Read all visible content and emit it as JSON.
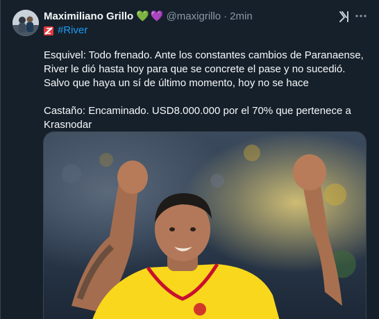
{
  "author": {
    "name": "Maximiliano Grillo",
    "hearts": [
      "💚",
      "💜"
    ],
    "handle": "@maxigrillo",
    "separator": "·",
    "time": "2min"
  },
  "hashtag": {
    "text": "#River",
    "flag_colors": [
      "#e03a3e",
      "#ffffff"
    ]
  },
  "body": {
    "paragraph1": "Esquivel: Todo frenado. Ante los constantes cambios de Paranaense, River le dió hasta hoy para que se concrete el pase y no sucedió. Salvo que haya un sí de último momento, hoy no se hace",
    "paragraph2": "Castaño: Encaminado. USD8.000.000 por el 70% que pertenece a Krasnodar"
  },
  "icons": {
    "grok": "grok-icon",
    "more": "more-icon"
  },
  "colors": {
    "background": "#15202b",
    "text": "#f7f9f9",
    "muted": "#8b98a5",
    "link": "#1d9bf0",
    "jersey": "#f9d71c"
  }
}
